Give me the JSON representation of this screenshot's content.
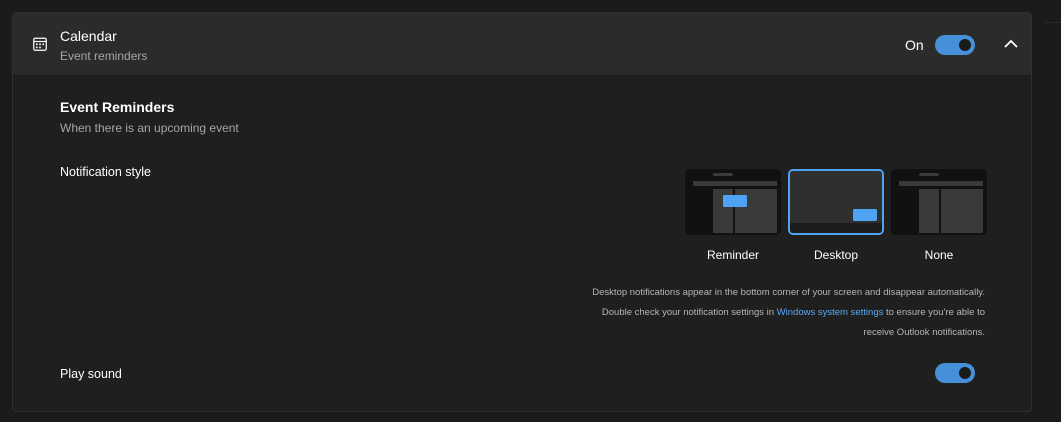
{
  "header": {
    "title": "Calendar",
    "subtitle": "Event reminders",
    "state_label": "On",
    "toggle_on": true,
    "icon": "calendar-icon",
    "collapse_icon": "chevron-up-icon"
  },
  "event_reminders": {
    "title": "Event Reminders",
    "subtitle": "When there is an upcoming event"
  },
  "notification_style": {
    "label": "Notification style",
    "options": [
      {
        "label": "Reminder",
        "selected": false
      },
      {
        "label": "Desktop",
        "selected": true
      },
      {
        "label": "None",
        "selected": false
      }
    ],
    "info_line1": "Desktop notifications appear in the bottom corner of your screen and disappear automatically.",
    "info_line2_prefix": "Double check your notification settings in ",
    "info_link": "Windows system settings",
    "info_line2_suffix": " to ensure you're able to",
    "info_line3": "receive Outlook notifications."
  },
  "play_sound": {
    "label": "Play sound",
    "toggle_on": true
  },
  "colors": {
    "accent": "#4590d8",
    "link": "#5aa9f5",
    "selected_border": "#4fa3f0"
  }
}
